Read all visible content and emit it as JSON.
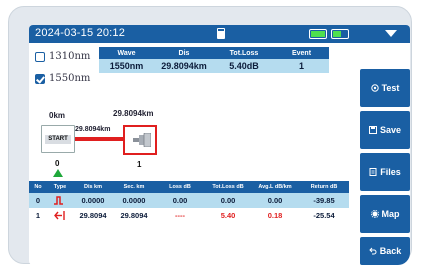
{
  "status_bar": {
    "datetime": "2024-03-15 20:12",
    "sd_icon": "sd-card-icon",
    "battery_color": "#4ee04e",
    "menu_icon": "menu-dropdown-icon"
  },
  "wavelengths": [
    {
      "label": "1310nm",
      "checked": false
    },
    {
      "label": "1550nm",
      "checked": true
    }
  ],
  "summary": {
    "headers": [
      "Wave",
      "Dis",
      "Tot.Loss",
      "Event"
    ],
    "row": [
      "1550nm",
      "29.8094km",
      "5.40dB",
      "1"
    ]
  },
  "event_map": {
    "start_distance": "0km",
    "end_distance": "29.8094km",
    "span_distance": "29.8094km",
    "start_label": "START",
    "start_index": "0",
    "end_index": "1",
    "fiber_color": "#e01f1f"
  },
  "events": {
    "headers": [
      "No",
      "Type",
      "Dis km",
      "Sec. km",
      "Loss dB",
      "Tot.Loss dB",
      "Avg.L dB/km",
      "Return dB"
    ],
    "rows": [
      {
        "no": "0",
        "type_icon": "launch-event-icon",
        "dis": "0.0000",
        "sec": "0.0000",
        "loss": "0.00",
        "tot": "0.00",
        "avg": "0.00",
        "ret": "-39.85"
      },
      {
        "no": "1",
        "type_icon": "end-event-icon",
        "dis": "29.8094",
        "sec": "29.8094",
        "loss": "----",
        "tot": "5.40",
        "avg": "0.18",
        "ret": "-25.54"
      }
    ]
  },
  "sidebar": {
    "test": "Test",
    "save": "Save",
    "files": "Files",
    "map": "Map",
    "back": "Back"
  },
  "colors": {
    "primary": "#1a5fa3",
    "row_highlight": "#b5dcef",
    "alert": "#e01f1f",
    "marker": "#1fa83a"
  }
}
